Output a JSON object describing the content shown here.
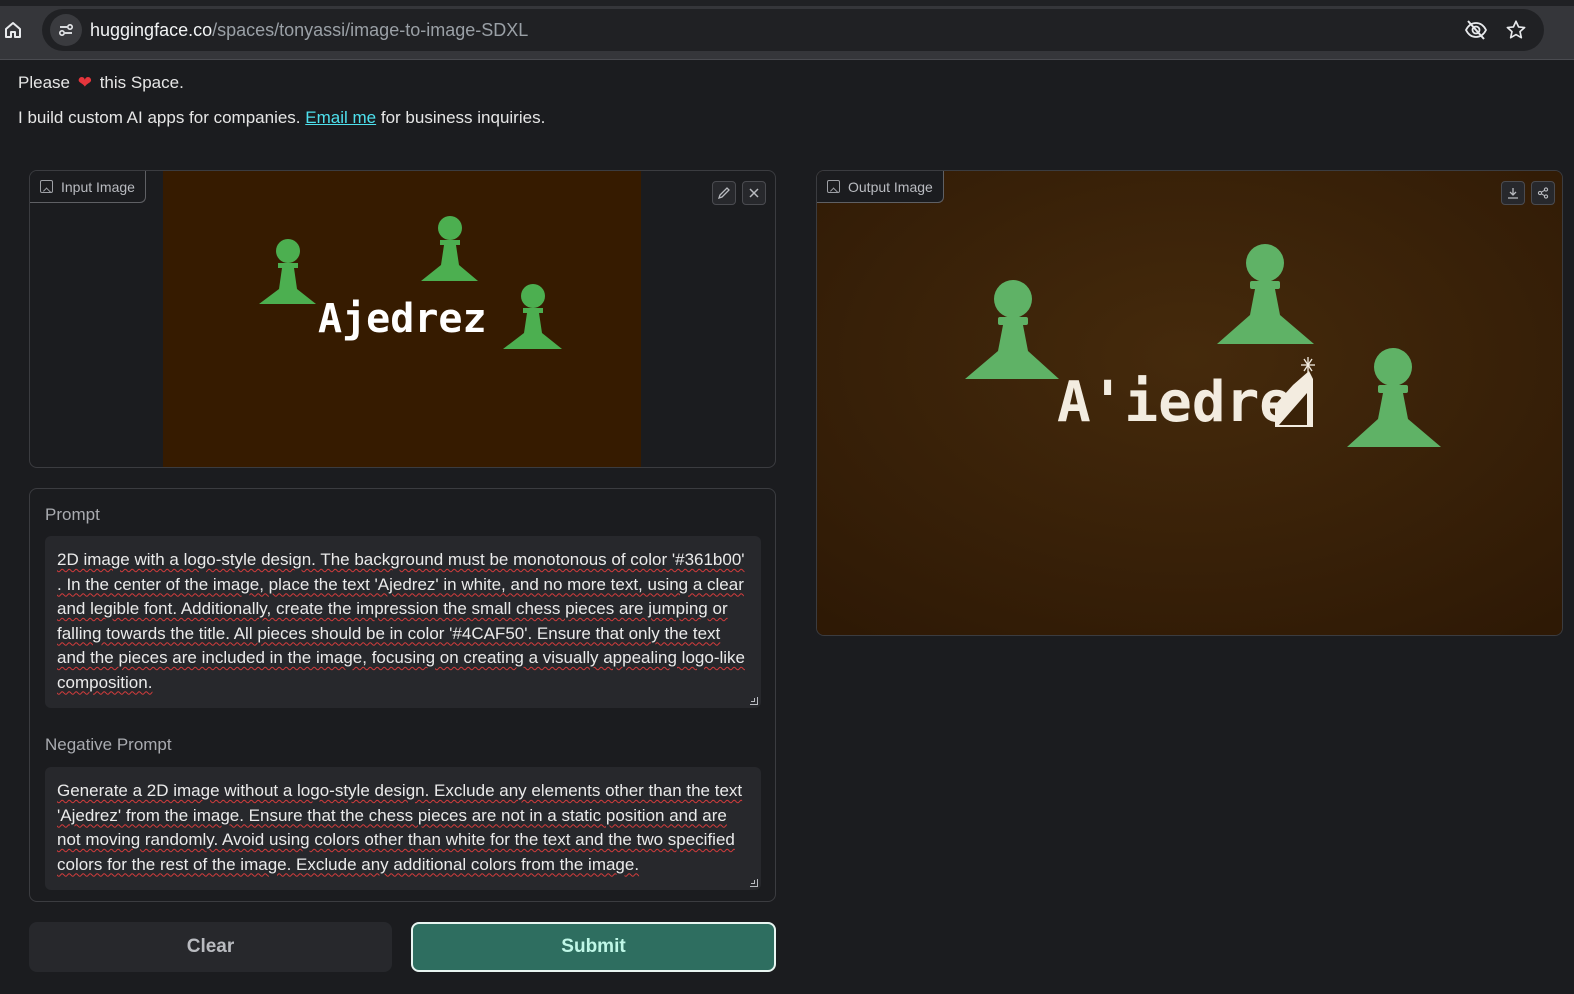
{
  "browser": {
    "url_host": "huggingface.co",
    "url_path": "/spaces/tonyassi/image-to-image-SDXL"
  },
  "intro": {
    "line1_before": "Please",
    "line1_heart": "❤",
    "line1_after": "this Space.",
    "line2_before": "I build custom AI apps for companies.",
    "line2_link": "Email me",
    "line2_after": "for business inquiries."
  },
  "input_image": {
    "label": "Input Image",
    "text": "Ajedrez",
    "background": "#361b00",
    "piece_color": "#4CAF50"
  },
  "output_image": {
    "label": "Output Image",
    "text": "A'iedre",
    "background": "#3a2208",
    "piece_color": "#5fb266"
  },
  "prompt": {
    "label": "Prompt",
    "value": "2D image with a logo-style design. The background must be monotonous of color '#361b00' . In the center of the image, place the text 'Ajedrez' in white, and no more text, using a clear and legible font. Additionally, create the impression the small chess pieces are jumping or falling towards the title. All pieces should be in color '#4CAF50'. Ensure that only the text and the pieces are included in the image, focusing on creating a visually appealing logo-like composition."
  },
  "negative_prompt": {
    "label": "Negative Prompt",
    "value": "Generate a 2D image without a logo-style design. Exclude any elements other than the text 'Ajedrez' from the image. Ensure that the chess pieces are not in a static position and are not moving randomly. Avoid using colors other than white for the text and the two specified colors for the rest of the image. Exclude any additional colors from the image."
  },
  "buttons": {
    "clear": "Clear",
    "submit": "Submit"
  }
}
